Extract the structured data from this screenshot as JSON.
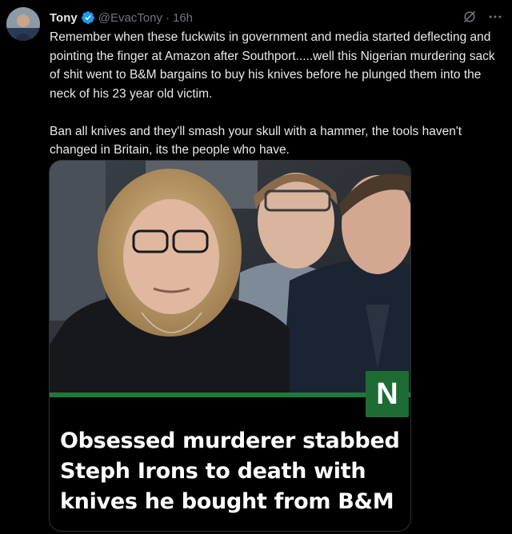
{
  "tweet": {
    "author_name": "Tony",
    "handle": "@EvacTony",
    "separator": "·",
    "time": "16h",
    "text": "Remember when these fuckwits in government and media started deflecting and pointing the finger at Amazon after Southport.....well this Nigerian murdering sack of shit went to B&M bargains to buy his knives before he plunged them into the neck of his 23 year old victim.\n\nBan all knives and they'll smash your skull with a hammer, the tools haven't changed in Britain, its the people who have."
  },
  "card": {
    "badge": "N",
    "headline": "Obsessed murderer stabbed Steph Irons to death with knives he bought from B&M"
  },
  "icons": {
    "verified": "verified-badge-icon",
    "grok": "grok-icon",
    "more": "more-icon"
  },
  "colors": {
    "background": "#000000",
    "text": "#e7e9ea",
    "muted": "#71767b",
    "verified": "#1d9bf0",
    "brand_green": "#1f6b35"
  }
}
